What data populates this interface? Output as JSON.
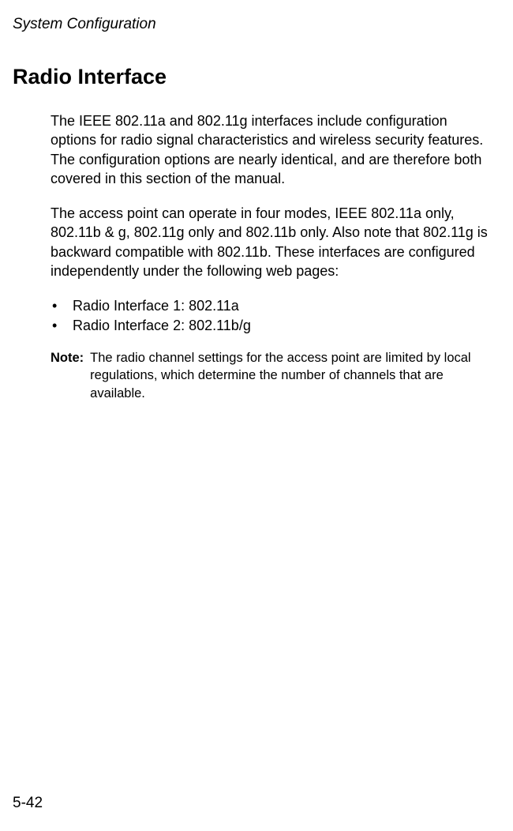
{
  "header": "System Configuration",
  "title": "Radio Interface",
  "para1": "The IEEE 802.11a and 802.11g interfaces include configuration options for radio signal characteristics and wireless security features. The configuration options are nearly identical, and are therefore both covered in this section of the manual.",
  "para2": "The access point can operate in four modes, IEEE 802.11a only, 802.11b & g, 802.11g only and 802.11b only. Also note that 802.11g is backward compatible with 802.11b. These interfaces are configured independently under the following web pages:",
  "bullets": {
    "item1": "Radio Interface 1: 802.11a",
    "item2": "Radio Interface 2: 802.11b/g"
  },
  "note": {
    "label": "Note:",
    "text": "The radio channel settings for the access point are limited by local regulations, which determine the number of channels that are available."
  },
  "pageNumber": "5-42"
}
